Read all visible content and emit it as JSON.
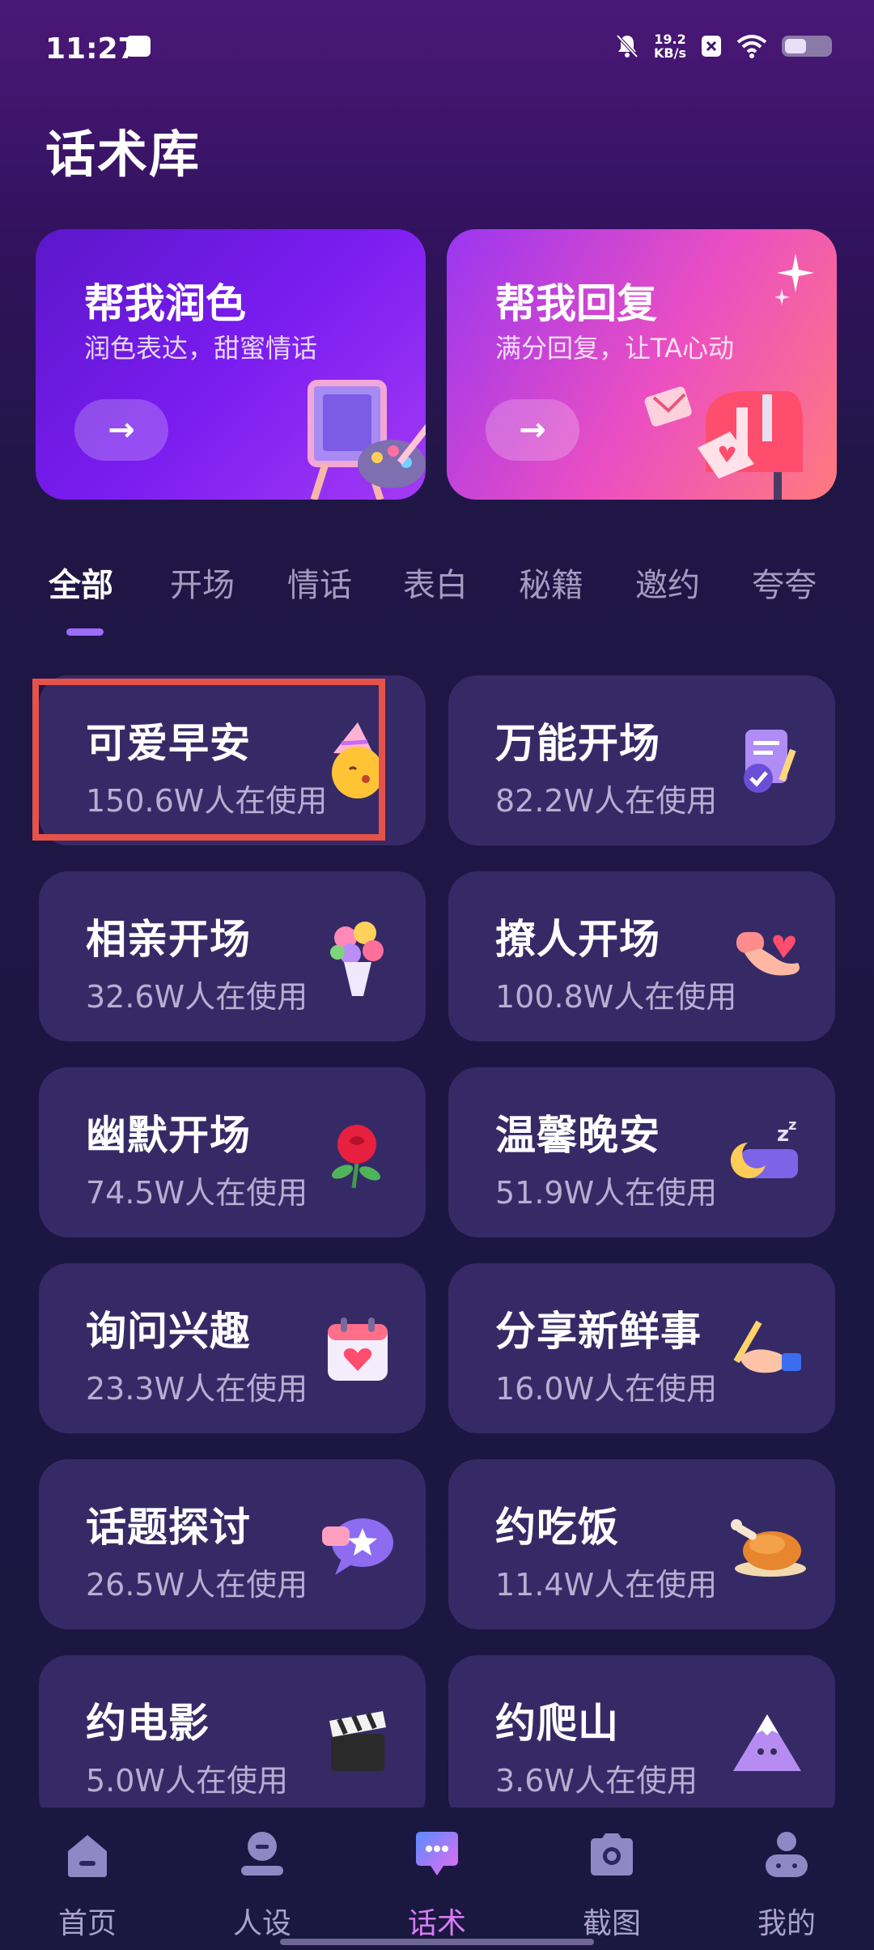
{
  "status_bar": {
    "time": "11:27",
    "speed_value": "19.2",
    "speed_unit": "KB/s"
  },
  "page_title": "话术库",
  "hero_cards": [
    {
      "title": "帮我润色",
      "subtitle": "润色表达，甜蜜情话",
      "arrow": "→"
    },
    {
      "title": "帮我回复",
      "subtitle": "满分回复，让TA心动",
      "arrow": "→"
    }
  ],
  "tabs": [
    "全部",
    "开场",
    "情话",
    "表白",
    "秘籍",
    "邀约",
    "夸夸"
  ],
  "active_tab": "全部",
  "cards": [
    {
      "title": "可爱早安",
      "usage": "150.6W人在使用",
      "icon": "party-emoji-icon"
    },
    {
      "title": "万能开场",
      "usage": "82.2W人在使用",
      "icon": "checklist-icon"
    },
    {
      "title": "相亲开场",
      "usage": "32.6W人在使用",
      "icon": "bouquet-icon"
    },
    {
      "title": "撩人开场",
      "usage": "100.8W人在使用",
      "icon": "hand-heart-icon"
    },
    {
      "title": "幽默开场",
      "usage": "74.5W人在使用",
      "icon": "rose-icon"
    },
    {
      "title": "温馨晚安",
      "usage": "51.9W人在使用",
      "icon": "moon-sleep-icon"
    },
    {
      "title": "询问兴趣",
      "usage": "23.3W人在使用",
      "icon": "calendar-heart-icon"
    },
    {
      "title": "分享新鲜事",
      "usage": "16.0W人在使用",
      "icon": "writing-hand-icon"
    },
    {
      "title": "话题探讨",
      "usage": "26.5W人在使用",
      "icon": "chat-star-icon"
    },
    {
      "title": "约吃饭",
      "usage": "11.4W人在使用",
      "icon": "roast-chicken-icon"
    },
    {
      "title": "约电影",
      "usage": "5.0W人在使用",
      "icon": "clapperboard-icon"
    },
    {
      "title": "约爬山",
      "usage": "3.6W人在使用",
      "icon": "mountain-icon"
    }
  ],
  "bottom_nav": [
    {
      "label": "首页",
      "icon": "home-icon"
    },
    {
      "label": "人设",
      "icon": "persona-icon"
    },
    {
      "label": "话术",
      "icon": "chat-icon"
    },
    {
      "label": "截图",
      "icon": "camera-icon"
    },
    {
      "label": "我的",
      "icon": "profile-icon"
    }
  ],
  "active_nav": "话术"
}
